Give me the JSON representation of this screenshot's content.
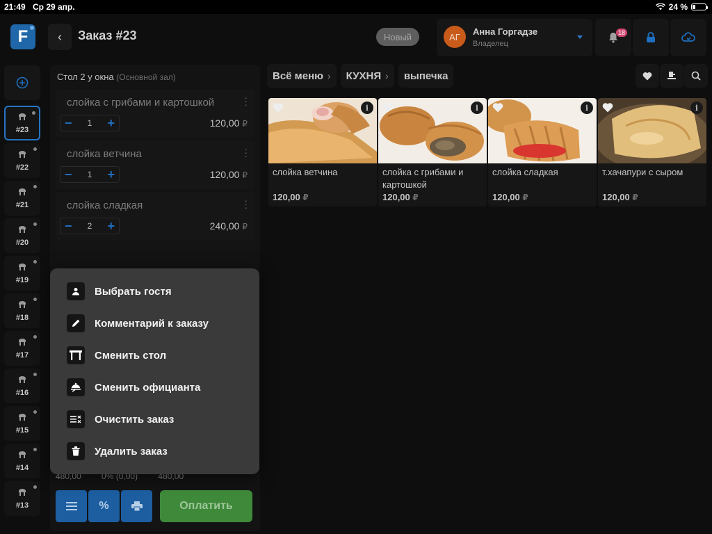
{
  "status_bar": {
    "time": "21:49",
    "date": "Ср 29 апр.",
    "battery": "24 %",
    "battery_level": 0.24
  },
  "header": {
    "logo_letter": "F",
    "title": "Заказ #23",
    "status": "Новый",
    "user": {
      "initials": "АГ",
      "name": "Анна Горгадзе",
      "role": "Владелец"
    },
    "notifications_count": "18"
  },
  "rail": {
    "tables": [
      {
        "num": "#23",
        "active": true
      },
      {
        "num": "#22"
      },
      {
        "num": "#21"
      },
      {
        "num": "#20"
      },
      {
        "num": "#19"
      },
      {
        "num": "#18"
      },
      {
        "num": "#17"
      },
      {
        "num": "#16"
      },
      {
        "num": "#15"
      },
      {
        "num": "#14"
      },
      {
        "num": "#13"
      }
    ]
  },
  "order": {
    "table": "Стол 2 у окна",
    "hall": "(Основной зал)",
    "items": [
      {
        "name": "слойка с грибами и картошкой",
        "qty": "1",
        "price": "120,00",
        "currency": "₽"
      },
      {
        "name": "слойка ветчина",
        "qty": "1",
        "price": "120,00",
        "currency": "₽"
      },
      {
        "name": "слойка сладкая",
        "qty": "2",
        "price": "240,00",
        "currency": "₽"
      }
    ],
    "totals": {
      "sum": "480,00",
      "discount": "0% (0,00)",
      "total": "480,00"
    },
    "buttons": {
      "percent": "%",
      "pay": "Оплатить"
    }
  },
  "menu": {
    "crumbs": [
      {
        "label": "Всё меню"
      },
      {
        "label": "КУХНЯ"
      },
      {
        "label": "выпечка"
      }
    ],
    "dishes": [
      {
        "name": "слойка ветчина",
        "price": "120,00",
        "currency": "₽"
      },
      {
        "name": "слойка с грибами и картошкой",
        "price": "120,00",
        "currency": "₽"
      },
      {
        "name": "слойка сладкая",
        "price": "120,00",
        "currency": "₽"
      },
      {
        "name": "т.хачапури с сыром",
        "price": "120,00",
        "currency": "₽"
      }
    ]
  },
  "context_menu": {
    "items": [
      {
        "label": "Выбрать гостя",
        "icon": "person-icon"
      },
      {
        "label": "Комментарий к заказу",
        "icon": "pencil-icon"
      },
      {
        "label": "Сменить стол",
        "icon": "table-icon"
      },
      {
        "label": "Сменить официанта",
        "icon": "waiter-icon"
      },
      {
        "label": "Очистить заказ",
        "icon": "clear-list-icon"
      },
      {
        "label": "Удалить заказ",
        "icon": "trash-icon"
      }
    ]
  },
  "colors": {
    "accent": "#1f6fc0",
    "pay": "#3f8a3a",
    "avatar": "#c85a1a",
    "badge": "#d0466f"
  }
}
